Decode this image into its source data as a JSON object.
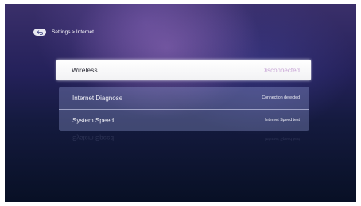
{
  "breadcrumb": {
    "text": "Settings > Internet",
    "back_icon": "back-arrow-icon"
  },
  "wireless": {
    "label": "Wireless",
    "status": "Disconnected",
    "status_color": "#c9a7d6"
  },
  "internet_diagnose": {
    "label": "Internet Diagnose",
    "status": "Connection detected"
  },
  "system_speed": {
    "label": "System Speed",
    "status": "Internet Speed test"
  }
}
